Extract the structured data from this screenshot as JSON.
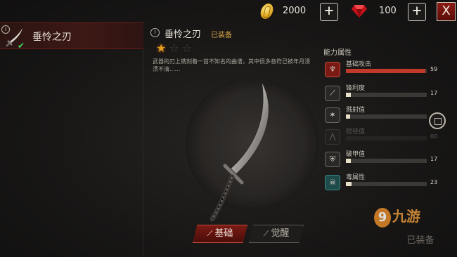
{
  "topbar": {
    "gold_value": "2000",
    "gem_value": "100",
    "close_label": "X",
    "plus_label": "+"
  },
  "left": {
    "item_name": "垂怜之刃",
    "tier_label": "I",
    "check": "✔"
  },
  "detail": {
    "tier_label": "I",
    "weapon_name": "垂怜之刃",
    "equipped_label": "已装备",
    "stars_filled": 1,
    "stars_total": 3,
    "description": "武器的刃上镌刻着一首不知名的曲谱，其中很多音符已被年月浸渍不清......"
  },
  "tabs": [
    {
      "label": "基础",
      "icon": "blade-icon",
      "active": true
    },
    {
      "label": "觉醒",
      "icon": "blade-icon",
      "active": false
    }
  ],
  "attributes": {
    "title": "能力属性",
    "items": [
      {
        "label": "基础攻击",
        "value": "59",
        "fill": 0.98,
        "icon": "strength-icon",
        "state": "active"
      },
      {
        "label": "锋利度",
        "value": "17",
        "fill": 0.06,
        "icon": "sharpness-icon",
        "state": "normal"
      },
      {
        "label": "溅射值",
        "value": "",
        "fill": 0.05,
        "icon": "splash-icon",
        "state": "normal"
      },
      {
        "label": "短径值",
        "value": "00",
        "fill": 0.0,
        "icon": "range-icon",
        "state": "dim"
      },
      {
        "label": "破甲值",
        "value": "17",
        "fill": 0.06,
        "icon": "armor-break-icon",
        "state": "normal"
      },
      {
        "label": "毒属性",
        "value": "23",
        "fill": 0.07,
        "icon": "poison-skull-icon",
        "state": "teal"
      }
    ]
  },
  "equip_button": "已装备",
  "watermark": {
    "glyph": "9",
    "text": "九游"
  },
  "colors": {
    "accent_red": "#c0392b",
    "gold": "#e3a020",
    "panel_bg": "#181716"
  }
}
